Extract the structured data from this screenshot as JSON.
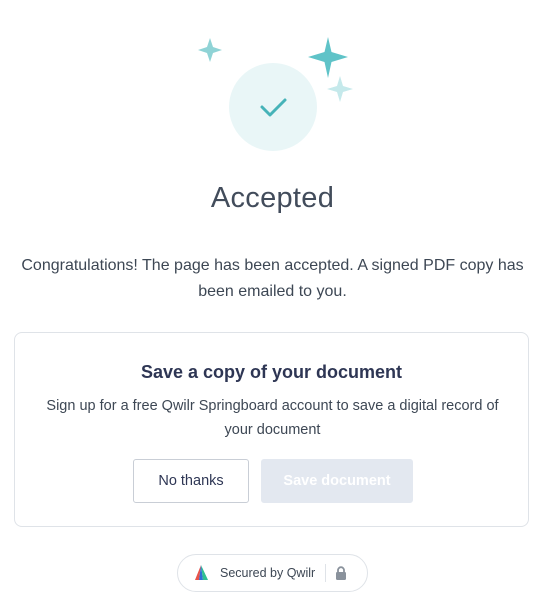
{
  "status": {
    "title": "Accepted",
    "message": "Congratulations! The page has been accepted. A signed PDF copy has been emailed to you.",
    "icon": "check-icon"
  },
  "save_card": {
    "title": "Save a copy of your document",
    "description": "Sign up for a free Qwilr Springboard account to save a digital record of your document",
    "no_thanks_label": "No thanks",
    "save_label": "Save document"
  },
  "footer": {
    "secured_label": "Secured by Qwilr",
    "logo_icon": "qwilr-logo-icon",
    "lock_icon": "lock-icon"
  },
  "colors": {
    "accent_teal": "#46b3b8",
    "circle_bg": "#e9f6f7",
    "sparkle": "#8fd3d6",
    "primary_disabled": "#e3e8f0"
  }
}
